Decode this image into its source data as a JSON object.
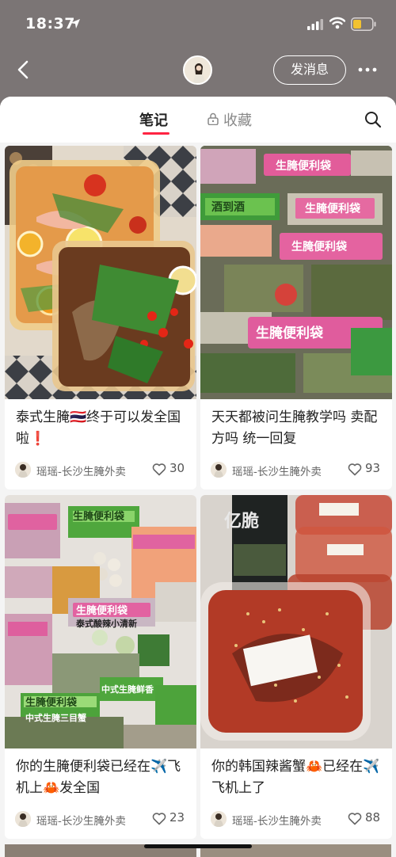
{
  "status_bar": {
    "time": "18:37",
    "battery_color": "#f2c230"
  },
  "header": {
    "message_button": "发消息"
  },
  "tabs": {
    "notes": "笔记",
    "collections": "收藏"
  },
  "colors": {
    "header_bg": "#7b7575",
    "accent": "#ff2442"
  },
  "notes": [
    {
      "title": "泰式生腌🇹🇭终于可以发全国啦❗",
      "author": "瑶瑶-长沙生腌外卖",
      "likes": "30",
      "cover": "photo of two trays of Thai-style raw seafood with limes, tomatoes and cilantro"
    },
    {
      "title": "天天都被问生腌教学吗 卖配方吗 统一回复",
      "author": "瑶瑶-长沙生腌外卖",
      "likes": "93",
      "cover": "photo of many pink and green labelled seasoning packets"
    },
    {
      "title": "你的生腌便利袋已经在✈️飞机上🦀发全国",
      "author": "瑶瑶-长沙生腌外卖",
      "likes": "23",
      "cover": "photo of green and pink labelled raw marinated seafood bags"
    },
    {
      "title": "你的韩国辣酱蟹🦀已经在✈️飞机上了",
      "author": "瑶瑶-长沙生腌外卖",
      "likes": "88",
      "cover": "photo of boxes of Korean spicy marinated crab with sesame"
    }
  ],
  "cover_labels": {
    "bag_brand": "生腌便利袋",
    "wine": "酒到酒",
    "tag_1": "中式生腌三目蟹",
    "tag_2": "泰式酸辣小清新",
    "tag_3": "中式生腌鲜香",
    "korean_brand": "亿脆"
  }
}
